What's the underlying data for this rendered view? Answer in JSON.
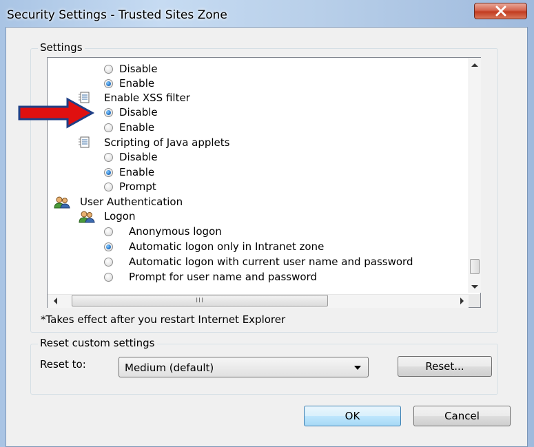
{
  "window": {
    "title": "Security Settings - Trusted Sites Zone"
  },
  "settings_group": {
    "legend": "Settings",
    "items": [
      {
        "kind": "radio",
        "label": "Disable",
        "checked": false
      },
      {
        "kind": "radio",
        "label": "Enable",
        "checked": true
      },
      {
        "kind": "category",
        "icon": "document-settings-icon",
        "label": "Enable XSS filter"
      },
      {
        "kind": "radio",
        "label": "Disable",
        "checked": true
      },
      {
        "kind": "radio",
        "label": "Enable",
        "checked": false
      },
      {
        "kind": "category",
        "icon": "document-settings-icon",
        "label": "Scripting of Java applets"
      },
      {
        "kind": "radio",
        "label": "Disable",
        "checked": false
      },
      {
        "kind": "radio",
        "label": "Enable",
        "checked": true
      },
      {
        "kind": "radio",
        "label": "Prompt",
        "checked": false
      },
      {
        "kind": "category",
        "icon": "users-icon",
        "label": "User Authentication"
      },
      {
        "kind": "category",
        "icon": "users-icon",
        "label": "Logon"
      },
      {
        "kind": "radio",
        "label": "Anonymous logon",
        "checked": false
      },
      {
        "kind": "radio",
        "label": "Automatic logon only in Intranet zone",
        "checked": true
      },
      {
        "kind": "radio",
        "label": "Automatic logon with current user name and password",
        "checked": false
      },
      {
        "kind": "radio",
        "label": "Prompt for user name and password",
        "checked": false
      }
    ],
    "hscroll_grip": "III",
    "note": "*Takes effect after you restart Internet Explorer"
  },
  "reset_group": {
    "legend": "Reset custom settings",
    "reset_to_label": "Reset to:",
    "reset_to_value": "Medium (default)",
    "reset_button": "Reset..."
  },
  "footer": {
    "ok_label": "OK",
    "cancel_label": "Cancel"
  },
  "colors": {
    "annotation_arrow": "#e01010",
    "annotation_arrow_outline": "#1f3f86"
  }
}
